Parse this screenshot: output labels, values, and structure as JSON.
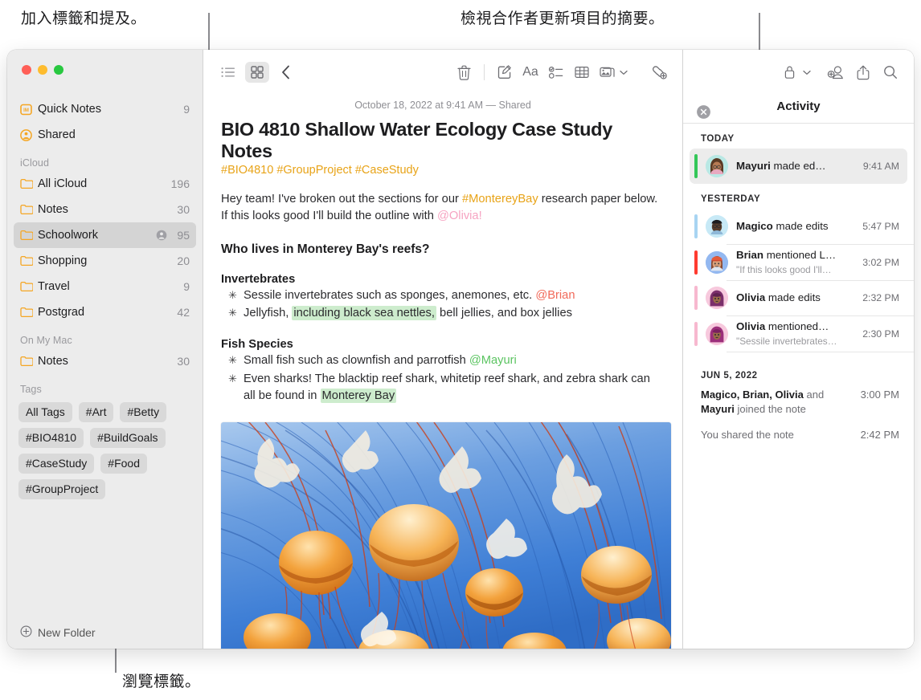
{
  "annotations": {
    "top_left": "加入標籤和提及。",
    "top_right": "檢視合作者更新項目的摘要。",
    "bottom": "瀏覽標籤。"
  },
  "sidebar": {
    "top_items": [
      {
        "label": "Quick Notes",
        "count": "9",
        "icon": "quick-note-icon"
      },
      {
        "label": "Shared",
        "count": "",
        "icon": "shared-person-icon"
      }
    ],
    "sections": [
      {
        "title": "iCloud",
        "items": [
          {
            "label": "All iCloud",
            "count": "196",
            "selected": false,
            "shared": false
          },
          {
            "label": "Notes",
            "count": "30",
            "selected": false,
            "shared": false
          },
          {
            "label": "Schoolwork",
            "count": "95",
            "selected": true,
            "shared": true
          },
          {
            "label": "Shopping",
            "count": "20",
            "selected": false,
            "shared": false
          },
          {
            "label": "Travel",
            "count": "9",
            "selected": false,
            "shared": false
          },
          {
            "label": "Postgrad",
            "count": "42",
            "selected": false,
            "shared": false
          }
        ]
      },
      {
        "title": "On My Mac",
        "items": [
          {
            "label": "Notes",
            "count": "30",
            "selected": false,
            "shared": false
          }
        ]
      }
    ],
    "tags_title": "Tags",
    "tags": [
      "All Tags",
      "#Art",
      "#Betty",
      "#BIO4810",
      "#BuildGoals",
      "#CaseStudy",
      "#Food",
      "#GroupProject"
    ],
    "new_folder_label": "New Folder"
  },
  "toolbar": {
    "left": [
      {
        "name": "list-view-icon",
        "active": false
      },
      {
        "name": "gallery-view-icon",
        "active": true
      },
      {
        "name": "back-chevron-icon",
        "active": false
      }
    ],
    "right": [
      {
        "name": "trash-icon"
      },
      {
        "name": "compose-icon"
      },
      {
        "name": "format-aa-icon"
      },
      {
        "name": "checklist-icon"
      },
      {
        "name": "table-icon"
      },
      {
        "name": "media-icon"
      },
      {
        "name": "quick-link-icon"
      }
    ]
  },
  "activity_toolbar": [
    {
      "name": "lock-icon"
    },
    {
      "name": "add-collaborator-icon"
    },
    {
      "name": "share-icon"
    },
    {
      "name": "search-icon"
    }
  ],
  "note": {
    "date": "October 18, 2022 at 9:41 AM — Shared",
    "title": "BIO 4810 Shallow Water Ecology Case Study Notes",
    "tagline": "#BIO4810 #GroupProject #CaseStudy",
    "intro_1": "Hey team! I've broken out the sections for our ",
    "intro_hash": "#MontereyBay",
    "intro_2": " research paper below. If this looks good I'll build the outline with ",
    "intro_mention": "@Olivia!",
    "heading": "Who lives in Monterey Bay's reefs?",
    "sub1": "Invertebrates",
    "inv_b1_a": "Sessile invertebrates such as sponges, anemones, etc. ",
    "inv_b1_mention": "@Brian",
    "inv_b2_a": "Jellyfish, ",
    "inv_b2_hl": "including black sea nettles,",
    "inv_b2_b": " bell jellies, and box jellies",
    "sub2": "Fish Species",
    "fish_b1_a": "Small fish such as clownfish and parrotfish ",
    "fish_b1_mention": "@Mayuri",
    "fish_b2_a": "Even sharks! The blacktip reef shark, whitetip reef shark, and zebra shark can all be found in ",
    "fish_b2_hl": "Monterey Bay",
    "image_alt": "jellyfish-photo"
  },
  "activity": {
    "close_icon": "close-icon",
    "title": "Activity",
    "groups": [
      {
        "title": "TODAY",
        "entries": [
          {
            "actor": "Mayuri",
            "action": " made ed…",
            "quote": "",
            "time": "9:41 AM",
            "bar_color": "#34c759",
            "avatar_bg": "#b9e8e4",
            "avatar_skin": "#b77b54",
            "avatar_hair": "#5a3a24",
            "selected": true
          }
        ]
      },
      {
        "title": "YESTERDAY",
        "entries": [
          {
            "actor": "Magico",
            "action": " made edits",
            "quote": "",
            "time": "5:47 PM",
            "bar_color": "#a8d4f2",
            "avatar_bg": "#c7e9f6",
            "avatar_skin": "#5a3e2b",
            "avatar_hair": "#1d1d1f",
            "selected": false
          },
          {
            "actor": "Brian",
            "action": " mentioned L…",
            "quote": "\"If this looks good I'll…",
            "time": "3:02 PM",
            "bar_color": "#ff3b30",
            "avatar_bg": "#93b8f0",
            "avatar_skin": "#d8a07a",
            "avatar_hair": "#8a4a32",
            "selected": false
          },
          {
            "actor": "Olivia",
            "action": " made edits",
            "quote": "",
            "time": "2:32 PM",
            "bar_color": "#f7b8cf",
            "avatar_bg": "#f7c9dd",
            "avatar_skin": "#9c6b4a",
            "avatar_hair": "#7b2f6b",
            "selected": false
          },
          {
            "actor": "Olivia",
            "action": " mentioned…",
            "quote": "\"Sessile invertebrates…",
            "time": "2:30 PM",
            "bar_color": "#f7b8cf",
            "avatar_bg": "#f7c9dd",
            "avatar_skin": "#9c6b4a",
            "avatar_hair": "#9c2f7b",
            "selected": false
          }
        ]
      }
    ],
    "history_title": "JUN 5, 2022",
    "history": [
      {
        "bold": "Magico, Brian, Olivia",
        "rest": " and ",
        "bold2": "Mayuri",
        "rest2": " joined the note",
        "time": "3:00 PM"
      },
      {
        "bold": "",
        "rest": "You shared the note",
        "bold2": "",
        "rest2": "",
        "time": "2:42 PM"
      }
    ]
  },
  "colors": {
    "accent_yellow": "#e8a317",
    "folder_orange": "#f5a623",
    "highlight_green": "#cdeccd",
    "selection_gray": "#d4d4d4"
  }
}
